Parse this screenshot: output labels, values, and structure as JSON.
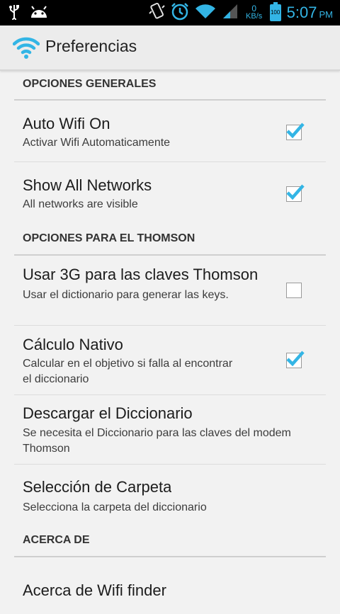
{
  "status_bar": {
    "time": "5:07",
    "ampm": "PM",
    "net_speed_value": "0",
    "net_speed_unit": "KB/s",
    "battery_level": "100",
    "icons": [
      "usb-icon",
      "android-icon",
      "vibrate-icon",
      "alarm-icon",
      "wifi-icon",
      "signal-icon",
      "battery-icon"
    ]
  },
  "action_bar": {
    "title": "Preferencias",
    "icon": "wifi-app-icon"
  },
  "categories": {
    "general": "OPCIONES GENERALES",
    "thomson": "OPCIONES PARA EL THOMSON",
    "about": "ACERCA DE"
  },
  "prefs": {
    "auto_wifi": {
      "title": "Auto Wifi On",
      "summary": "Activar Wifi Automaticamente",
      "checked": true
    },
    "show_all": {
      "title": "Show All Networks",
      "summary": "All networks are visible",
      "checked": true
    },
    "use_3g": {
      "title": "Usar 3G para las claves Thomson",
      "summary": "Usar el dictionario para generar las keys.",
      "checked": false
    },
    "nativo": {
      "title": "Cálculo Nativo",
      "summary": "Calcular en el objetivo si falla al encontrar el diccionario",
      "checked": true
    },
    "descargar": {
      "title": "Descargar el Diccionario",
      "summary": "Se necesita el Diccionario para las claves del modem Thomson"
    },
    "carpeta": {
      "title": "Selección de Carpeta",
      "summary": "Selecciona la carpeta del diccionario"
    },
    "acerca": {
      "title": "Acerca de Wifi finder"
    }
  },
  "colors": {
    "accent": "#33b5e5",
    "background": "#f2f2f2"
  }
}
